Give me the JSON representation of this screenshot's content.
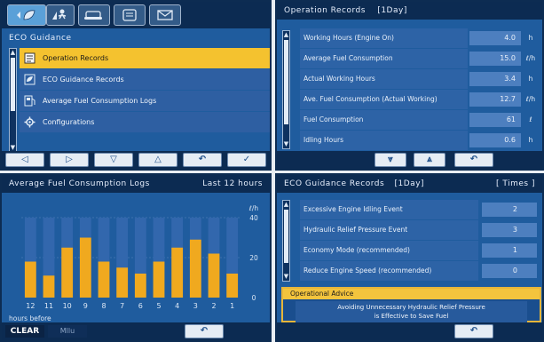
{
  "top_left": {
    "header": "ECO Guidance",
    "items": [
      {
        "label": "Operation Records",
        "selected": true
      },
      {
        "label": "ECO Guidance Records",
        "selected": false
      },
      {
        "label": "Average Fuel Consumption Logs",
        "selected": false
      },
      {
        "label": "Configurations",
        "selected": false
      }
    ],
    "buttons": [
      "◁",
      "▷",
      "▽",
      "△",
      "↶",
      "✓"
    ]
  },
  "top_right": {
    "header": "Operation Records",
    "period": "[1Day]",
    "rows": [
      {
        "label": "Working Hours (Engine On)",
        "value": "4.0",
        "unit": "h"
      },
      {
        "label": "Average Fuel Consumption",
        "value": "15.0",
        "unit": "ℓ/h"
      },
      {
        "label": "Actual Working Hours",
        "value": "3.4",
        "unit": "h"
      },
      {
        "label": "Ave. Fuel Consumption (Actual Working)",
        "value": "12.7",
        "unit": "ℓ/h"
      },
      {
        "label": "Fuel Consumption",
        "value": "61",
        "unit": "ℓ"
      },
      {
        "label": "Idling Hours",
        "value": "0.6",
        "unit": "h"
      }
    ],
    "buttons": [
      "⩔",
      "⩓",
      "↶"
    ]
  },
  "bottom_left": {
    "header": "Average Fuel Consumption Logs",
    "range": "Last 12 hours",
    "clear_label": "CLEAR",
    "menu_label": "Mllu",
    "back_label": "↶",
    "chart_data": {
      "type": "bar",
      "categories": [
        "12",
        "11",
        "10",
        "9",
        "8",
        "7",
        "6",
        "5",
        "4",
        "3",
        "2",
        "1"
      ],
      "values": [
        18,
        11,
        25,
        30,
        18,
        15,
        12,
        18,
        25,
        29,
        22,
        12
      ],
      "ylim": [
        0,
        40
      ],
      "yticks": [
        "40",
        "20",
        "0"
      ],
      "yunit": "ℓ/h",
      "xlabel": "hours before",
      "bar_color": "#f0a91f",
      "background_bar_color": "#3267ad"
    }
  },
  "bottom_right": {
    "header": "ECO Guidance Records",
    "period": "[1Day]",
    "col_label": "[ Times ]",
    "rows": [
      {
        "label": "Excessive Engine Idling Event",
        "value": "2"
      },
      {
        "label": "Hydraulic Relief Pressure Event",
        "value": "3"
      },
      {
        "label": "Economy Mode (recommended)",
        "value": "1"
      },
      {
        "label": "Reduce Engine Speed (recommended)",
        "value": "0"
      }
    ],
    "advice_title": "Operational Advice",
    "advice_line1": "Avoiding Unnecessary Hydraulic Relief Pressure",
    "advice_line2": "is Effective to Save Fuel",
    "back_label": "↶"
  },
  "colors": {
    "panel": "#1f5c9e",
    "header": "#0c2b52",
    "selected": "#f4c22f"
  }
}
